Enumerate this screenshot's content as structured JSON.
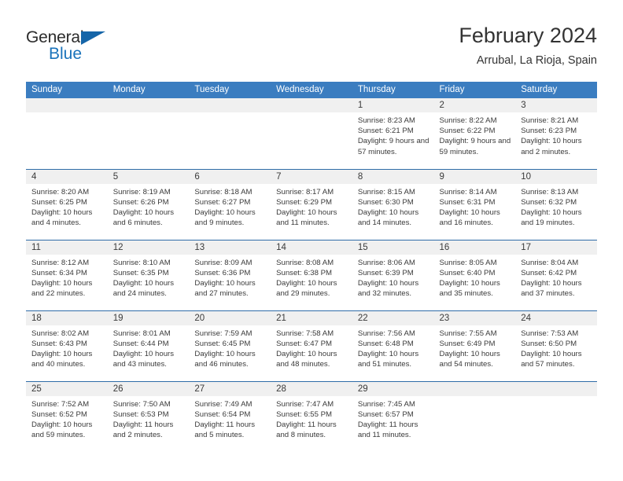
{
  "brand": {
    "name_part1": "General",
    "name_part2": "Blue",
    "triangle_icon": "triangle-icon",
    "color_dark": "#2b2b2b",
    "color_blue": "#1a73bb"
  },
  "header": {
    "title": "February 2024",
    "subtitle": "Arrubal, La Rioja, Spain"
  },
  "theme": {
    "header_blue": "#3b7dc0",
    "row_divider_blue": "#2f6ca8",
    "daynum_band": "#f0f0f0",
    "text": "#3a3a3a"
  },
  "weekdays": [
    "Sunday",
    "Monday",
    "Tuesday",
    "Wednesday",
    "Thursday",
    "Friday",
    "Saturday"
  ],
  "weeks": [
    [
      {
        "day": "",
        "sunrise": "",
        "sunset": "",
        "daylight": "",
        "empty": true
      },
      {
        "day": "",
        "sunrise": "",
        "sunset": "",
        "daylight": "",
        "empty": true
      },
      {
        "day": "",
        "sunrise": "",
        "sunset": "",
        "daylight": "",
        "empty": true
      },
      {
        "day": "",
        "sunrise": "",
        "sunset": "",
        "daylight": "",
        "empty": true
      },
      {
        "day": "1",
        "sunrise": "Sunrise: 8:23 AM",
        "sunset": "Sunset: 6:21 PM",
        "daylight": "Daylight: 9 hours and 57 minutes.",
        "empty": false
      },
      {
        "day": "2",
        "sunrise": "Sunrise: 8:22 AM",
        "sunset": "Sunset: 6:22 PM",
        "daylight": "Daylight: 9 hours and 59 minutes.",
        "empty": false
      },
      {
        "day": "3",
        "sunrise": "Sunrise: 8:21 AM",
        "sunset": "Sunset: 6:23 PM",
        "daylight": "Daylight: 10 hours and 2 minutes.",
        "empty": false
      }
    ],
    [
      {
        "day": "4",
        "sunrise": "Sunrise: 8:20 AM",
        "sunset": "Sunset: 6:25 PM",
        "daylight": "Daylight: 10 hours and 4 minutes.",
        "empty": false
      },
      {
        "day": "5",
        "sunrise": "Sunrise: 8:19 AM",
        "sunset": "Sunset: 6:26 PM",
        "daylight": "Daylight: 10 hours and 6 minutes.",
        "empty": false
      },
      {
        "day": "6",
        "sunrise": "Sunrise: 8:18 AM",
        "sunset": "Sunset: 6:27 PM",
        "daylight": "Daylight: 10 hours and 9 minutes.",
        "empty": false
      },
      {
        "day": "7",
        "sunrise": "Sunrise: 8:17 AM",
        "sunset": "Sunset: 6:29 PM",
        "daylight": "Daylight: 10 hours and 11 minutes.",
        "empty": false
      },
      {
        "day": "8",
        "sunrise": "Sunrise: 8:15 AM",
        "sunset": "Sunset: 6:30 PM",
        "daylight": "Daylight: 10 hours and 14 minutes.",
        "empty": false
      },
      {
        "day": "9",
        "sunrise": "Sunrise: 8:14 AM",
        "sunset": "Sunset: 6:31 PM",
        "daylight": "Daylight: 10 hours and 16 minutes.",
        "empty": false
      },
      {
        "day": "10",
        "sunrise": "Sunrise: 8:13 AM",
        "sunset": "Sunset: 6:32 PM",
        "daylight": "Daylight: 10 hours and 19 minutes.",
        "empty": false
      }
    ],
    [
      {
        "day": "11",
        "sunrise": "Sunrise: 8:12 AM",
        "sunset": "Sunset: 6:34 PM",
        "daylight": "Daylight: 10 hours and 22 minutes.",
        "empty": false
      },
      {
        "day": "12",
        "sunrise": "Sunrise: 8:10 AM",
        "sunset": "Sunset: 6:35 PM",
        "daylight": "Daylight: 10 hours and 24 minutes.",
        "empty": false
      },
      {
        "day": "13",
        "sunrise": "Sunrise: 8:09 AM",
        "sunset": "Sunset: 6:36 PM",
        "daylight": "Daylight: 10 hours and 27 minutes.",
        "empty": false
      },
      {
        "day": "14",
        "sunrise": "Sunrise: 8:08 AM",
        "sunset": "Sunset: 6:38 PM",
        "daylight": "Daylight: 10 hours and 29 minutes.",
        "empty": false
      },
      {
        "day": "15",
        "sunrise": "Sunrise: 8:06 AM",
        "sunset": "Sunset: 6:39 PM",
        "daylight": "Daylight: 10 hours and 32 minutes.",
        "empty": false
      },
      {
        "day": "16",
        "sunrise": "Sunrise: 8:05 AM",
        "sunset": "Sunset: 6:40 PM",
        "daylight": "Daylight: 10 hours and 35 minutes.",
        "empty": false
      },
      {
        "day": "17",
        "sunrise": "Sunrise: 8:04 AM",
        "sunset": "Sunset: 6:42 PM",
        "daylight": "Daylight: 10 hours and 37 minutes.",
        "empty": false
      }
    ],
    [
      {
        "day": "18",
        "sunrise": "Sunrise: 8:02 AM",
        "sunset": "Sunset: 6:43 PM",
        "daylight": "Daylight: 10 hours and 40 minutes.",
        "empty": false
      },
      {
        "day": "19",
        "sunrise": "Sunrise: 8:01 AM",
        "sunset": "Sunset: 6:44 PM",
        "daylight": "Daylight: 10 hours and 43 minutes.",
        "empty": false
      },
      {
        "day": "20",
        "sunrise": "Sunrise: 7:59 AM",
        "sunset": "Sunset: 6:45 PM",
        "daylight": "Daylight: 10 hours and 46 minutes.",
        "empty": false
      },
      {
        "day": "21",
        "sunrise": "Sunrise: 7:58 AM",
        "sunset": "Sunset: 6:47 PM",
        "daylight": "Daylight: 10 hours and 48 minutes.",
        "empty": false
      },
      {
        "day": "22",
        "sunrise": "Sunrise: 7:56 AM",
        "sunset": "Sunset: 6:48 PM",
        "daylight": "Daylight: 10 hours and 51 minutes.",
        "empty": false
      },
      {
        "day": "23",
        "sunrise": "Sunrise: 7:55 AM",
        "sunset": "Sunset: 6:49 PM",
        "daylight": "Daylight: 10 hours and 54 minutes.",
        "empty": false
      },
      {
        "day": "24",
        "sunrise": "Sunrise: 7:53 AM",
        "sunset": "Sunset: 6:50 PM",
        "daylight": "Daylight: 10 hours and 57 minutes.",
        "empty": false
      }
    ],
    [
      {
        "day": "25",
        "sunrise": "Sunrise: 7:52 AM",
        "sunset": "Sunset: 6:52 PM",
        "daylight": "Daylight: 10 hours and 59 minutes.",
        "empty": false
      },
      {
        "day": "26",
        "sunrise": "Sunrise: 7:50 AM",
        "sunset": "Sunset: 6:53 PM",
        "daylight": "Daylight: 11 hours and 2 minutes.",
        "empty": false
      },
      {
        "day": "27",
        "sunrise": "Sunrise: 7:49 AM",
        "sunset": "Sunset: 6:54 PM",
        "daylight": "Daylight: 11 hours and 5 minutes.",
        "empty": false
      },
      {
        "day": "28",
        "sunrise": "Sunrise: 7:47 AM",
        "sunset": "Sunset: 6:55 PM",
        "daylight": "Daylight: 11 hours and 8 minutes.",
        "empty": false
      },
      {
        "day": "29",
        "sunrise": "Sunrise: 7:45 AM",
        "sunset": "Sunset: 6:57 PM",
        "daylight": "Daylight: 11 hours and 11 minutes.",
        "empty": false
      },
      {
        "day": "",
        "sunrise": "",
        "sunset": "",
        "daylight": "",
        "empty": true
      },
      {
        "day": "",
        "sunrise": "",
        "sunset": "",
        "daylight": "",
        "empty": true
      }
    ]
  ]
}
